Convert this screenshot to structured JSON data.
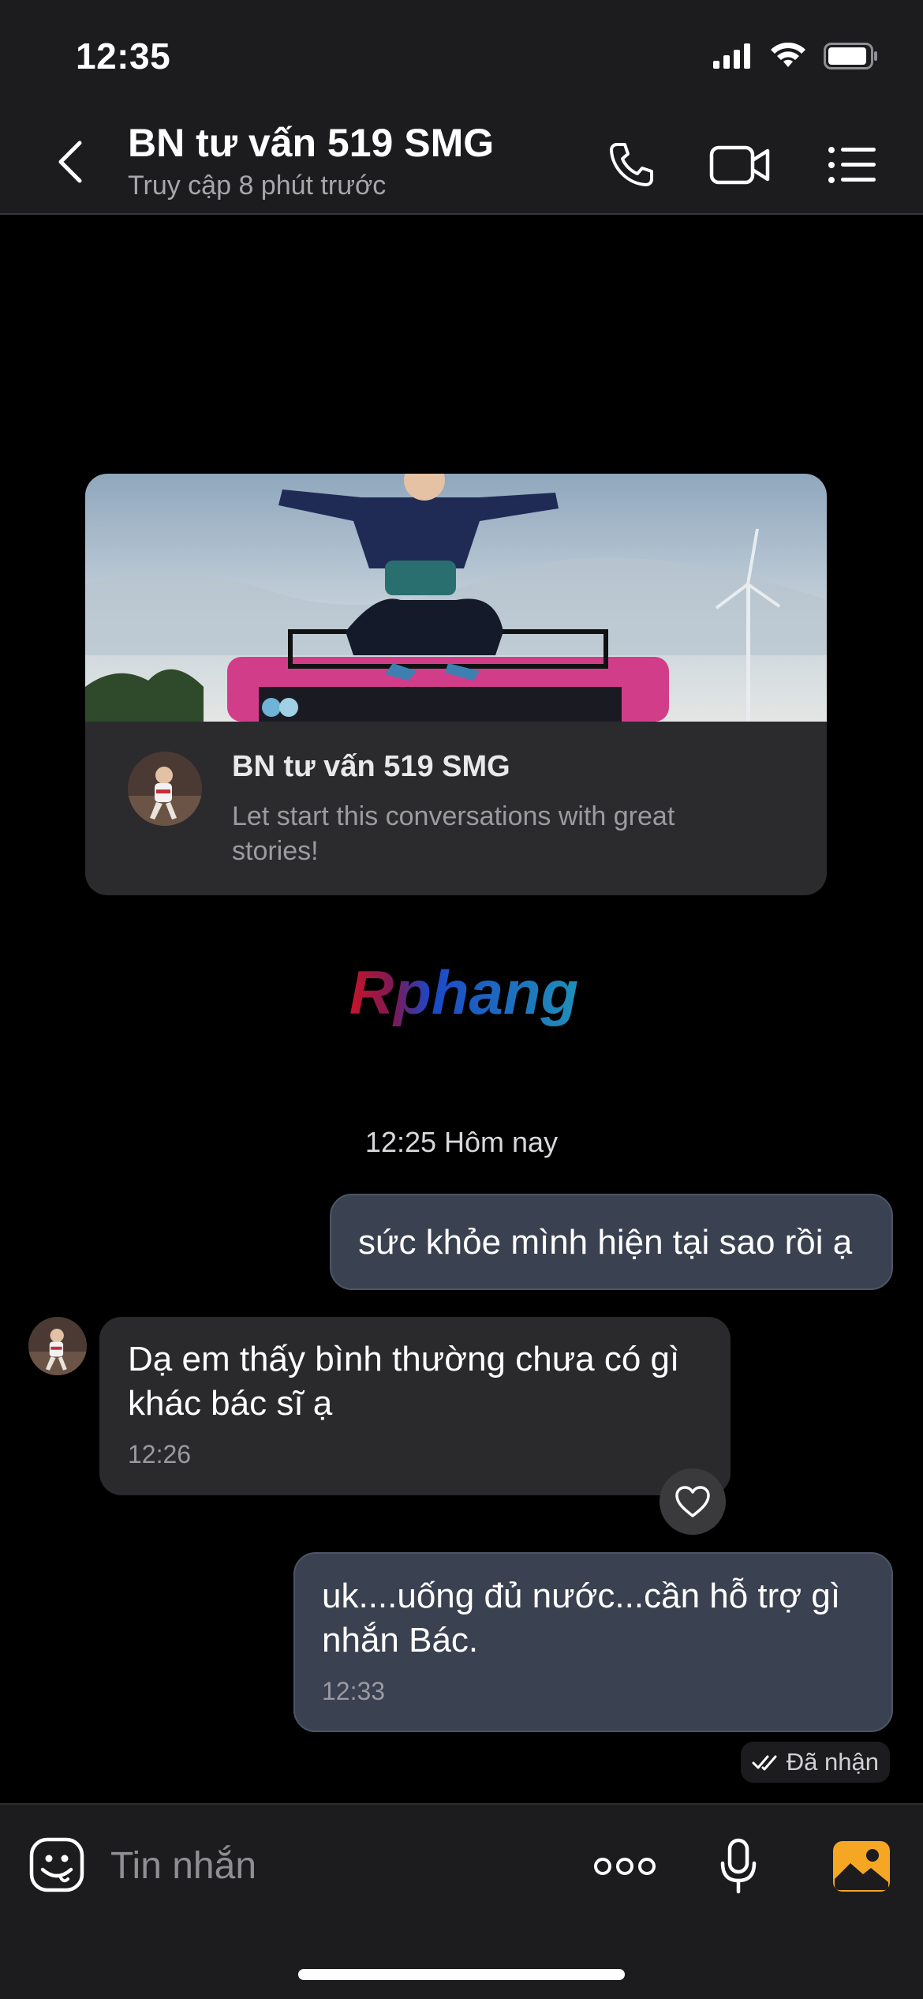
{
  "status_bar": {
    "time": "12:35"
  },
  "header": {
    "title": "BN tư vấn 519 SMG",
    "subtitle": "Truy cập 8 phút trước"
  },
  "profile_card": {
    "name": "BN tư vấn 519 SMG",
    "description": "Let start this conversations with great stories!"
  },
  "logo": {
    "text": "Rphang"
  },
  "date_separator": "12:25 Hôm nay",
  "messages": [
    {
      "direction": "outgoing",
      "text": "sức khỏe mình hiện tại sao rồi ạ",
      "time": ""
    },
    {
      "direction": "incoming",
      "text": "Dạ em thấy bình thường chưa có gì khác bác sĩ ạ",
      "time": "12:26"
    },
    {
      "direction": "outgoing",
      "text": "uk....uống đủ nước...cần hỗ trợ gì nhắn Bác.",
      "time": "12:33"
    }
  ],
  "delivery_status": "Đã nhận",
  "composer": {
    "placeholder": "Tin nhắn"
  },
  "colors": {
    "accent_image_button": "#f5a623",
    "outgoing_bubble": "#3a4150",
    "incoming_bubble": "#2a2a2c"
  }
}
